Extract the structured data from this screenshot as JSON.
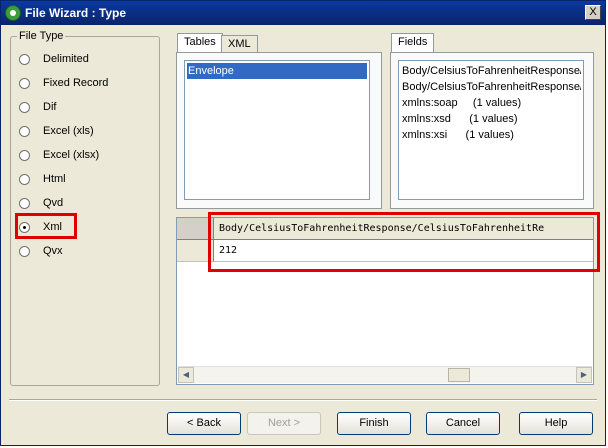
{
  "window": {
    "title": "File Wizard : Type",
    "close_label": "X"
  },
  "file_type": {
    "legend": "File Type",
    "options": [
      {
        "label": "Delimited",
        "selected": false
      },
      {
        "label": "Fixed Record",
        "selected": false
      },
      {
        "label": "Dif",
        "selected": false
      },
      {
        "label": "Excel (xls)",
        "selected": false
      },
      {
        "label": "Excel (xlsx)",
        "selected": false
      },
      {
        "label": "Html",
        "selected": false
      },
      {
        "label": "Qvd",
        "selected": false
      },
      {
        "label": "Xml",
        "selected": true
      },
      {
        "label": "Qvx",
        "selected": false
      }
    ]
  },
  "tables": {
    "tabs": [
      {
        "label": "Tables",
        "active": true
      },
      {
        "label": "XML",
        "active": false
      }
    ],
    "items": [
      {
        "label": "Envelope",
        "selected": true
      }
    ]
  },
  "fields": {
    "tab_label": "Fields",
    "items": [
      "Body/CelsiusToFahrenheitResponse/Ce",
      "Body/CelsiusToFahrenheitResponse/xr",
      "xmlns:soap     (1 values)",
      "xmlns:xsd      (1 values)",
      "xmlns:xsi      (1 values)"
    ]
  },
  "preview": {
    "column_header": "Body/CelsiusToFahrenheitResponse/CelsiusToFahrenheitRe",
    "rows": [
      "212"
    ]
  },
  "buttons": {
    "back": "< Back",
    "next": "Next >",
    "finish": "Finish",
    "cancel": "Cancel",
    "help": "Help"
  },
  "colors": {
    "selection": "#316ac5",
    "highlight": "#e00000",
    "titlebar": "#0a246a"
  },
  "icons": {
    "title": "qlikview-icon",
    "close": "close-icon",
    "scroll_left": "arrow-left-icon",
    "scroll_right": "arrow-right-icon"
  }
}
